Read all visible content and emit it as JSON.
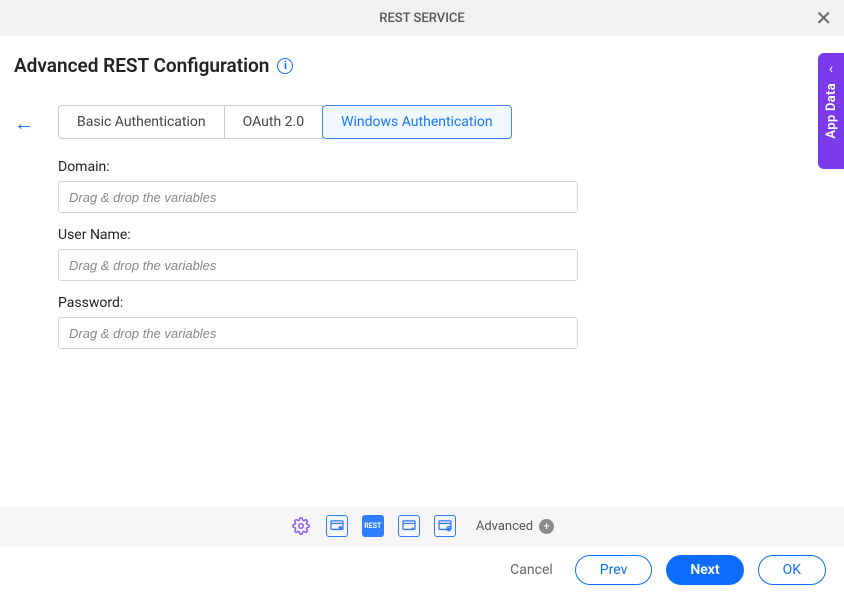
{
  "header": {
    "title": "REST SERVICE"
  },
  "page": {
    "title": "Advanced REST Configuration"
  },
  "tabs": [
    {
      "label": "Basic Authentication",
      "active": false
    },
    {
      "label": "OAuth 2.0",
      "active": false
    },
    {
      "label": "Windows Authentication",
      "active": true
    }
  ],
  "form": {
    "domain": {
      "label": "Domain:",
      "placeholder": "Drag & drop the variables",
      "value": ""
    },
    "username": {
      "label": "User Name:",
      "placeholder": "Drag & drop the variables",
      "value": ""
    },
    "password": {
      "label": "Password:",
      "placeholder": "Drag & drop the variables",
      "value": ""
    }
  },
  "side_panel": {
    "label": "App Data"
  },
  "footer_icons": {
    "advanced_label": "Advanced"
  },
  "buttons": {
    "cancel": "Cancel",
    "prev": "Prev",
    "next": "Next",
    "ok": "OK"
  }
}
